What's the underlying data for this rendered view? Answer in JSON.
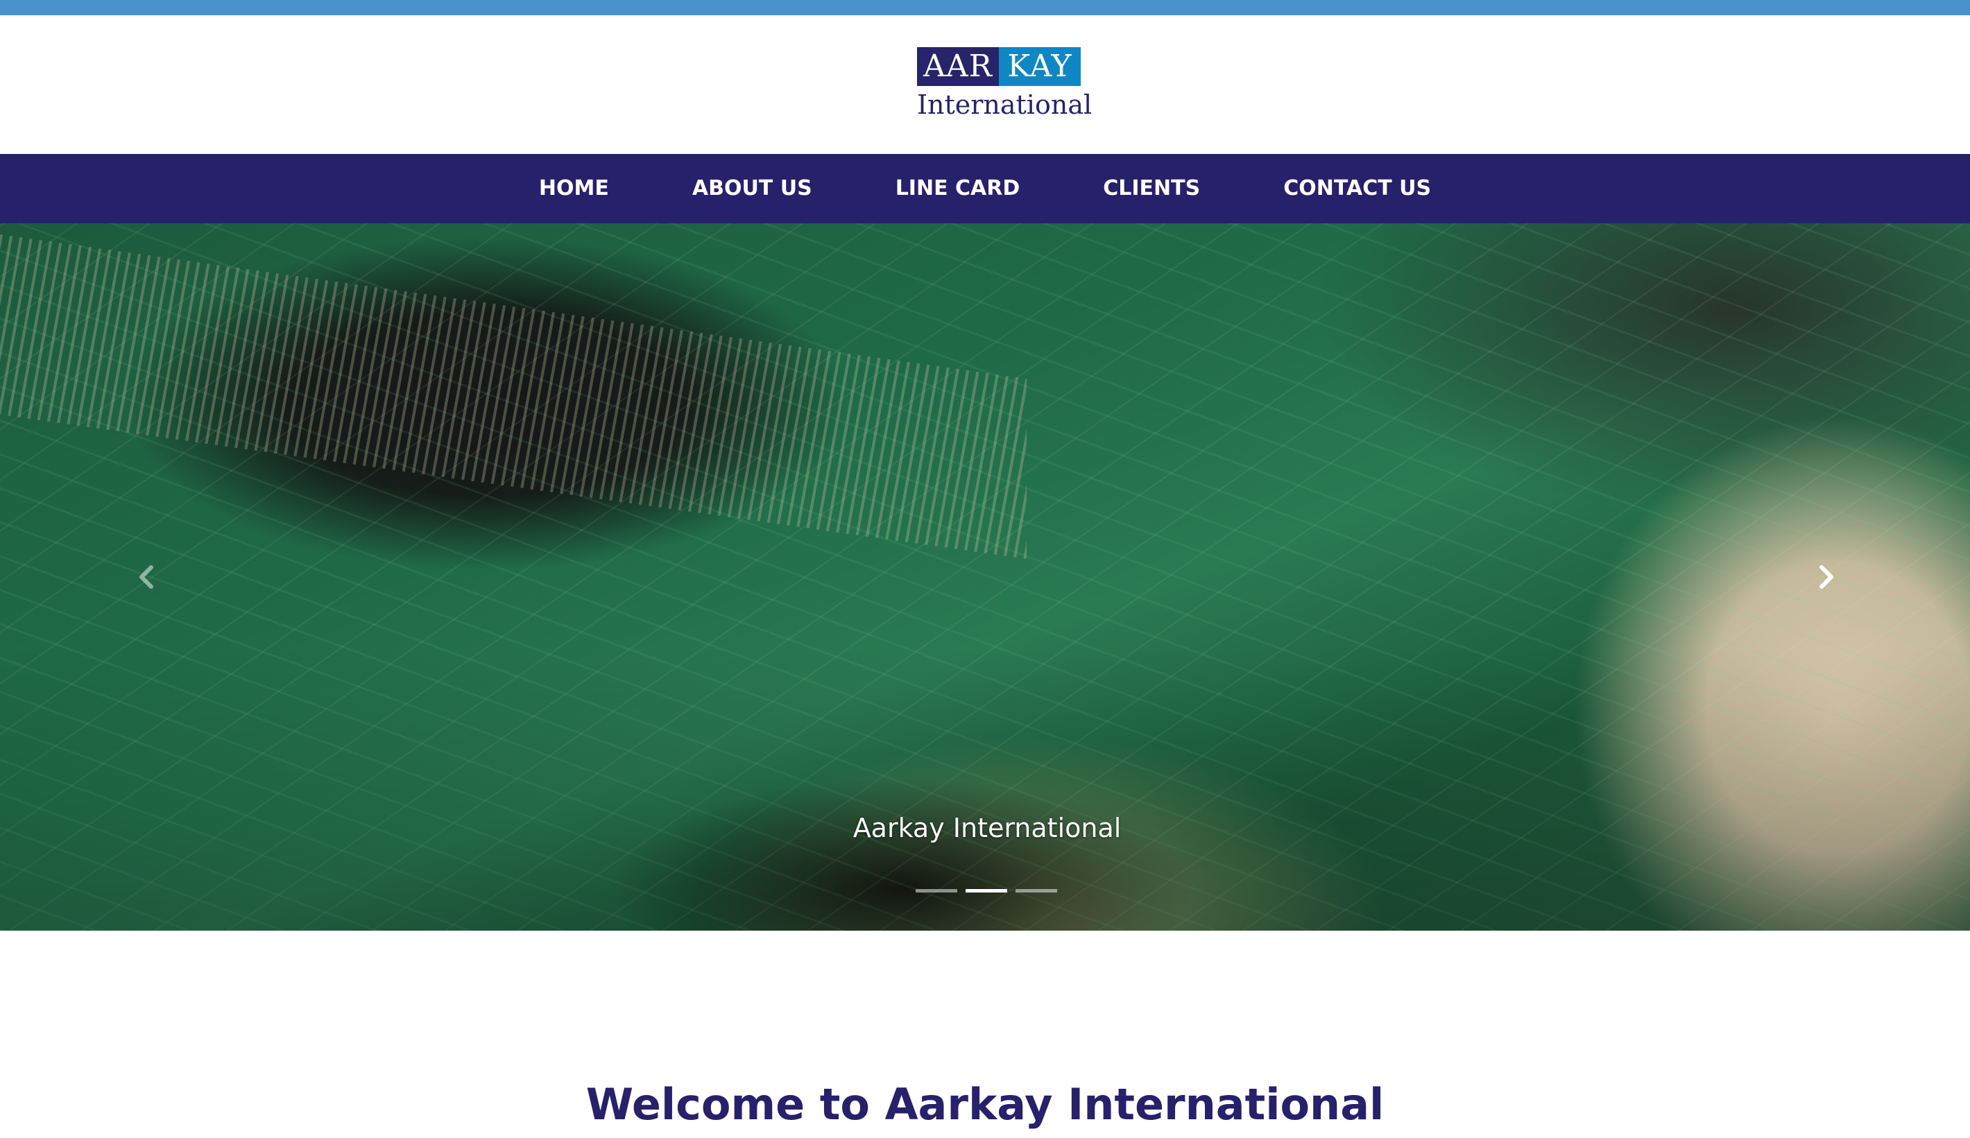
{
  "logo": {
    "aar": "AAR",
    "kay": "KAY",
    "subtitle": "International"
  },
  "nav": {
    "items": [
      {
        "label": "HOME"
      },
      {
        "label": "ABOUT US"
      },
      {
        "label": "LINE CARD"
      },
      {
        "label": "CLIENTS"
      },
      {
        "label": "CONTACT US"
      }
    ]
  },
  "hero": {
    "caption": "Aarkay International",
    "prev_icon": "chevron-left-icon",
    "next_icon": "chevron-right-icon",
    "slides_count": 3,
    "active_slide": 2
  },
  "welcome": {
    "heading": "Welcome to Aarkay International"
  },
  "colors": {
    "top_strip": "#4b92cc",
    "nav_background": "#27206a",
    "logo_aar": "#27246a",
    "logo_kay": "#0f87c4",
    "heading": "#27206a"
  }
}
